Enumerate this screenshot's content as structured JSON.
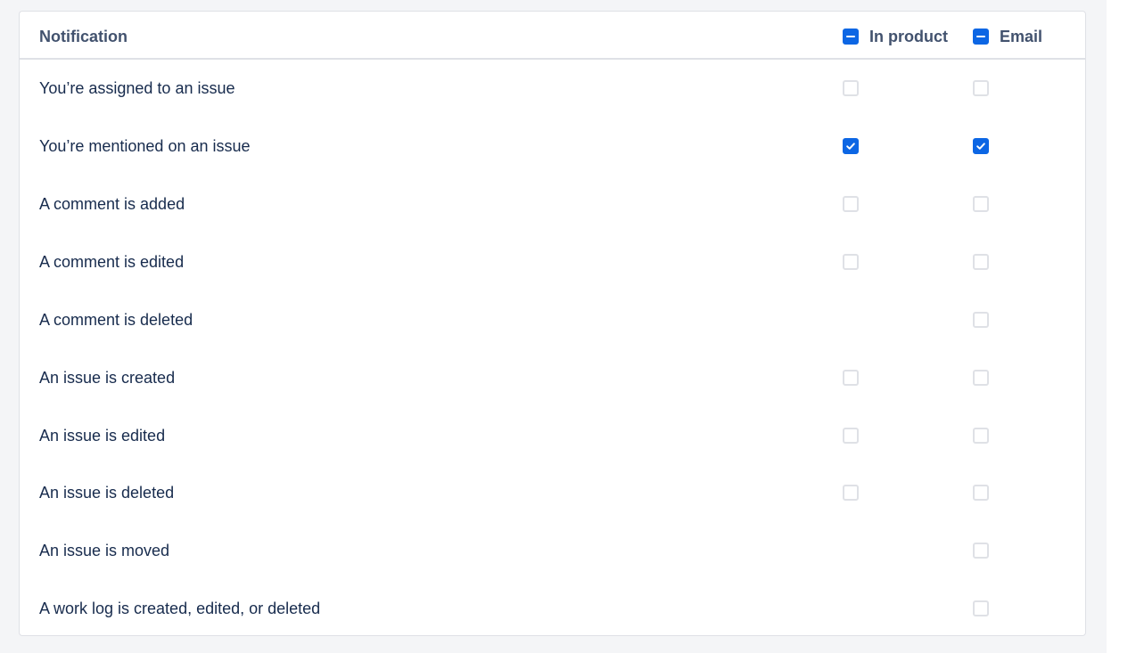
{
  "header": {
    "notification_label": "Notification",
    "in_product_label": "In product",
    "email_label": "Email",
    "in_product_state": "indeterminate",
    "email_state": "indeterminate"
  },
  "rows": [
    {
      "label": "You’re assigned to an issue",
      "in_product": "unchecked",
      "email": "unchecked"
    },
    {
      "label": "You’re mentioned on an issue",
      "in_product": "checked",
      "email": "checked"
    },
    {
      "label": "A comment is added",
      "in_product": "unchecked",
      "email": "unchecked"
    },
    {
      "label": "A comment is edited",
      "in_product": "unchecked",
      "email": "unchecked"
    },
    {
      "label": "A comment is deleted",
      "in_product": "none",
      "email": "unchecked"
    },
    {
      "label": "An issue is created",
      "in_product": "unchecked",
      "email": "unchecked"
    },
    {
      "label": "An issue is edited",
      "in_product": "unchecked",
      "email": "unchecked"
    },
    {
      "label": "An issue is deleted",
      "in_product": "unchecked",
      "email": "unchecked"
    },
    {
      "label": "An issue is moved",
      "in_product": "none",
      "email": "unchecked"
    },
    {
      "label": "A work log is created, edited, or deleted",
      "in_product": "none",
      "email": "unchecked"
    }
  ],
  "colors": {
    "accent": "#0c66e4",
    "checkbox_border": "#dfe1e6",
    "text": "#172b4d",
    "header_text": "#42526e",
    "page_bg": "#f4f5f7"
  }
}
